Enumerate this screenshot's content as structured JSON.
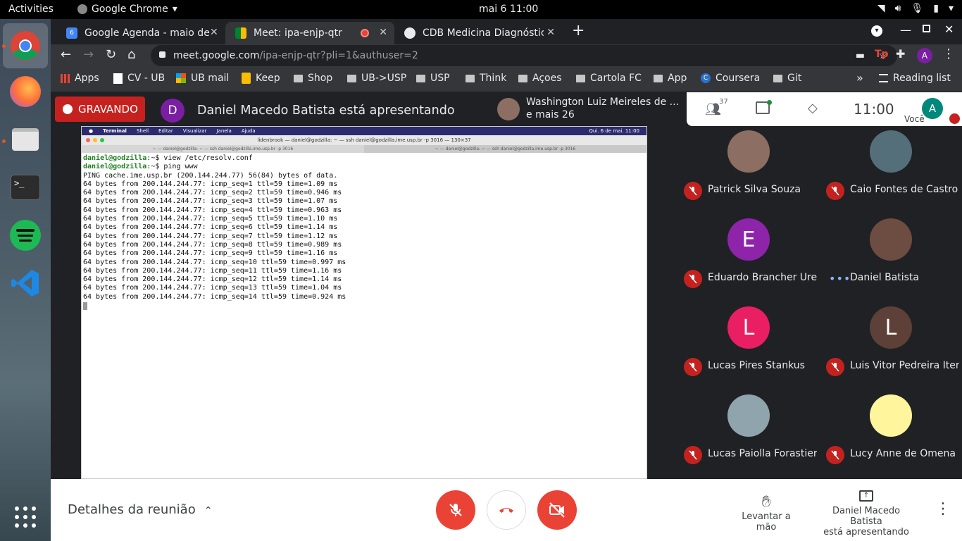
{
  "topbar": {
    "activities": "Activities",
    "app": "Google Chrome",
    "clock": "mai 6  11:00"
  },
  "tabs": [
    {
      "title": "Google Agenda - maio de",
      "close": "✕"
    },
    {
      "title": "Meet: ipa-enjp-qtr",
      "close": "✕"
    },
    {
      "title": "CDB Medicina Diagnóstic",
      "close": "✕"
    }
  ],
  "omnibox": {
    "host": "meet.google.com",
    "path": "/ipa-enjp-qtr?pli=1&authuser=2"
  },
  "profile_initial": "A",
  "bookmarks": [
    "Apps",
    "CV - UB",
    "UB mail",
    "Keep",
    "Shop",
    "UB->USP",
    "USP",
    "Think",
    "Açoes",
    "Cartola FC",
    "App",
    "Coursera",
    "Git"
  ],
  "reading_list": "Reading list",
  "meet": {
    "recording": "GRAVANDO",
    "presenter_initial": "D",
    "presenter_text": "Daniel Macedo Batista está apresentando",
    "other_name": "Washington Luiz Meireles de ...",
    "other_more": "e mais 26",
    "people_count": "37",
    "time": "11:00",
    "you": "Você",
    "you_initial": "A"
  },
  "terminal": {
    "menubar": [
      "Terminal",
      "Shell",
      "Editar",
      "Visualizar",
      "Janela",
      "Ajuda"
    ],
    "menubar_clock": "Qui. 6 de mai. 11:00",
    "window_title": "lidenbrook — daniel@godzilla: ~ — ssh daniel@godzilla.ime.usp.br -p 3016 — 130×37",
    "tab1": "~ — daniel@godzilla: ~ — ssh daniel@godzilla.ime.usp.br -p 3016",
    "tab2": "~ — daniel@godzilla: ~ — ssh daniel@godzilla.ime.usp.br -p 3016",
    "prompt": "daniel@godzilla",
    "cmd1": ":~$ view /etc/resolv.conf",
    "cmd2": ":~$ ping www",
    "output": [
      "PING cache.ime.usp.br (200.144.244.77) 56(84) bytes of data.",
      "64 bytes from 200.144.244.77: icmp_seq=1 ttl=59 time=1.09 ms",
      "64 bytes from 200.144.244.77: icmp_seq=2 ttl=59 time=0.946 ms",
      "64 bytes from 200.144.244.77: icmp_seq=3 ttl=59 time=1.07 ms",
      "64 bytes from 200.144.244.77: icmp_seq=4 ttl=59 time=0.963 ms",
      "64 bytes from 200.144.244.77: icmp_seq=5 ttl=59 time=1.10 ms",
      "64 bytes from 200.144.244.77: icmp_seq=6 ttl=59 time=1.14 ms",
      "64 bytes from 200.144.244.77: icmp_seq=7 ttl=59 time=1.12 ms",
      "64 bytes from 200.144.244.77: icmp_seq=8 ttl=59 time=0.989 ms",
      "64 bytes from 200.144.244.77: icmp_seq=9 ttl=59 time=1.16 ms",
      "64 bytes from 200.144.244.77: icmp_seq=10 ttl=59 time=0.997 ms",
      "64 bytes from 200.144.244.77: icmp_seq=11 ttl=59 time=1.16 ms",
      "64 bytes from 200.144.244.77: icmp_seq=12 ttl=59 time=1.14 ms",
      "64 bytes from 200.144.244.77: icmp_seq=13 ttl=59 time=1.04 ms",
      "64 bytes from 200.144.244.77: icmp_seq=14 ttl=59 time=0.924 ms"
    ]
  },
  "participants": [
    {
      "name": "Patrick Silva Souza",
      "initial": "",
      "color": "#8d6e63",
      "muted": true
    },
    {
      "name": "Caio Fontes de Castro",
      "initial": "",
      "color": "#546e7a",
      "muted": true
    },
    {
      "name": "Eduardo Brancher Ure...",
      "initial": "E",
      "color": "#8e24aa",
      "muted": true
    },
    {
      "name": "Daniel Batista",
      "initial": "",
      "color": "#6d4c41",
      "muted": false
    },
    {
      "name": "Lucas Pires Stankus",
      "initial": "L",
      "color": "#e91e63",
      "muted": true
    },
    {
      "name": "Luis Vitor Pedreira Iten...",
      "initial": "L",
      "color": "#5d4037",
      "muted": true
    },
    {
      "name": "Lucas Paiolla Forastiere",
      "initial": "",
      "color": "#90a4ae",
      "muted": true
    },
    {
      "name": "Lucy Anne de Omena ...",
      "initial": "",
      "color": "#fff59d",
      "muted": true
    }
  ],
  "bottom": {
    "details": "Detalhes da reunião",
    "raise_hand": "Levantar a mão",
    "presenting_line1": "Daniel Macedo Batista",
    "presenting_line2": "está apresentando"
  }
}
